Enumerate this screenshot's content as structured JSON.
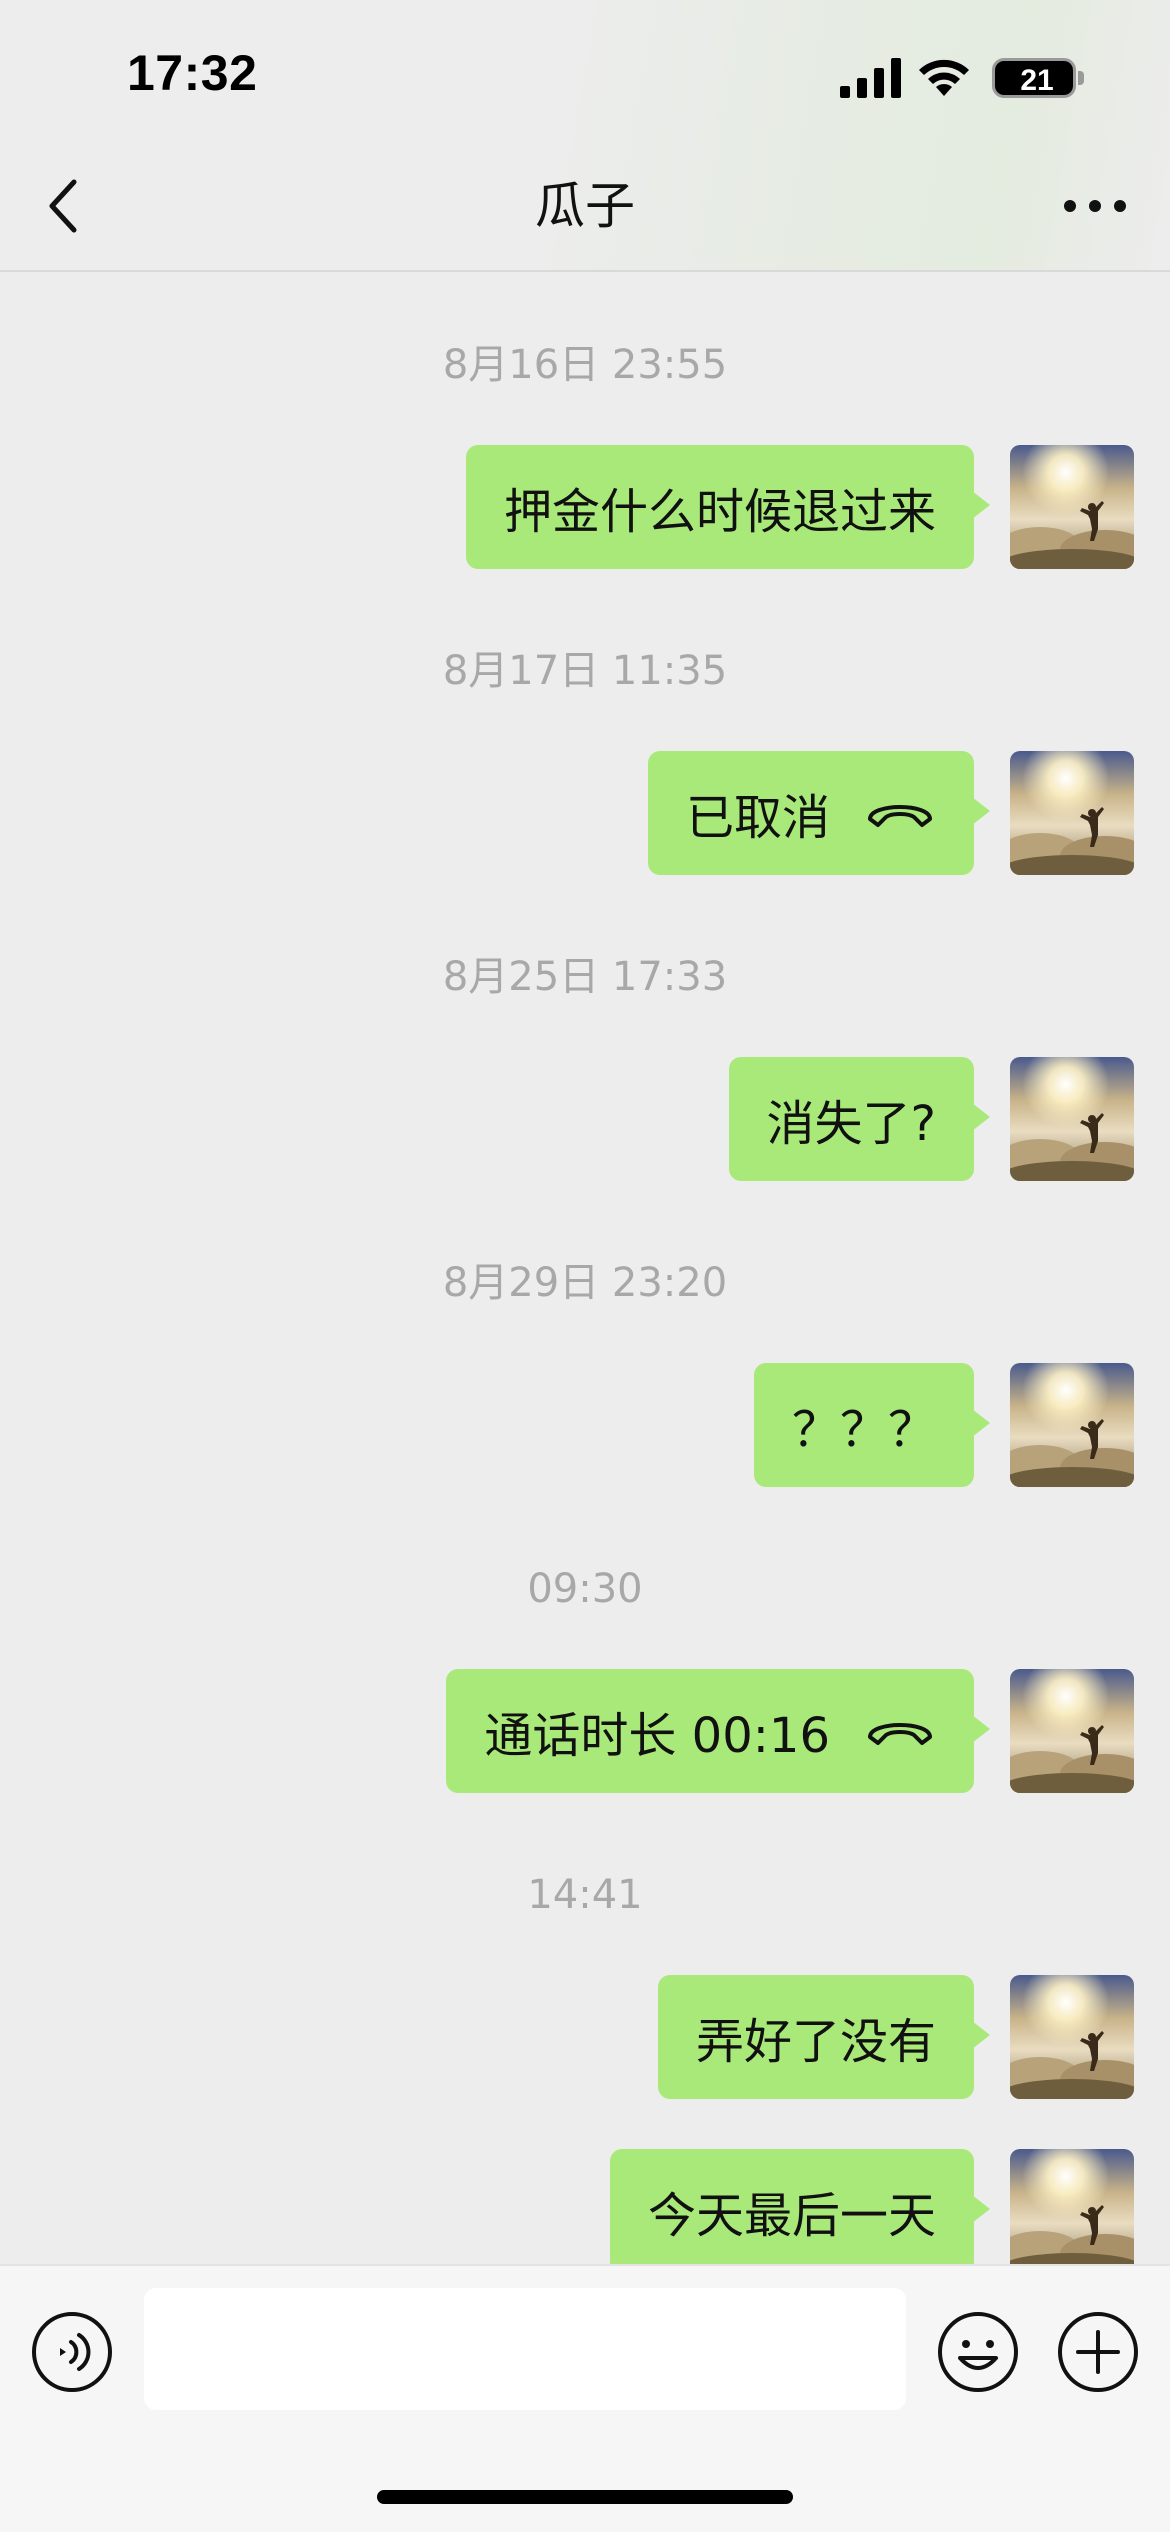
{
  "status_bar": {
    "time": "17:32",
    "battery_level": "21"
  },
  "header": {
    "title": "瓜子"
  },
  "messages": [
    {
      "timestamp": "8月16日 23:55",
      "text": "押金什么时候退过来"
    },
    {
      "timestamp": "8月17日 11:35",
      "text": "已取消",
      "call_icon": "hangup-phone-icon"
    },
    {
      "timestamp": "8月25日 17:33",
      "text": "消失了?"
    },
    {
      "timestamp": "8月29日 23:20",
      "text": "？？？"
    },
    {
      "timestamp": "09:30",
      "text": "通话时长 00:16",
      "call_icon": "hangup-phone-icon"
    },
    {
      "timestamp": "14:41",
      "text": "弄好了没有"
    },
    {
      "text": "今天最后一天"
    }
  ],
  "colors": {
    "bubble": "#a9e97a",
    "background": "#ededed",
    "timestamp": "#a8a8a8"
  }
}
